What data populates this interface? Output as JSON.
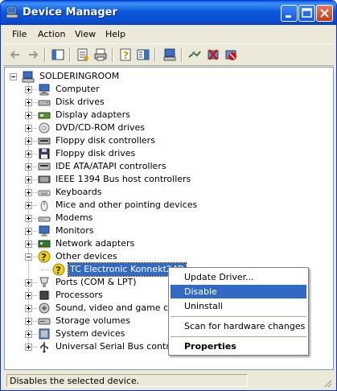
{
  "window": {
    "title": "Device Manager",
    "titlebar_color": "#0a54d8",
    "controls": [
      "minimize-icon",
      "maximize-icon",
      "close-icon"
    ]
  },
  "menubar": {
    "items": [
      "File",
      "Action",
      "View",
      "Help"
    ]
  },
  "toolbar": {
    "icons": [
      "back-arrow-icon",
      "forward-arrow-icon",
      "show-hide-console-tree-icon",
      "properties-icon",
      "print-icon",
      "help-icon",
      "view-icon",
      "computer-icon",
      "scan-hardware-icon",
      "update-driver-icon",
      "uninstall-icon",
      "disable-icon"
    ]
  },
  "tree": {
    "root": "SOLDERINGROOM",
    "categories": [
      {
        "label": "Computer",
        "icon": "computer-icon"
      },
      {
        "label": "Disk drives",
        "icon": "disk-drive-icon"
      },
      {
        "label": "Display adapters",
        "icon": "display-adapter-icon"
      },
      {
        "label": "DVD/CD-ROM drives",
        "icon": "cd-drive-icon"
      },
      {
        "label": "Floppy disk controllers",
        "icon": "floppy-controller-icon"
      },
      {
        "label": "Floppy disk drives",
        "icon": "floppy-drive-icon"
      },
      {
        "label": "IDE ATA/ATAPI controllers",
        "icon": "ide-controller-icon"
      },
      {
        "label": "IEEE 1394 Bus host controllers",
        "icon": "firewire-icon"
      },
      {
        "label": "Keyboards",
        "icon": "keyboard-icon"
      },
      {
        "label": "Mice and other pointing devices",
        "icon": "mouse-icon"
      },
      {
        "label": "Modems",
        "icon": "modem-icon"
      },
      {
        "label": "Monitors",
        "icon": "monitor-icon"
      },
      {
        "label": "Network adapters",
        "icon": "network-adapter-icon"
      },
      {
        "label": "Other devices",
        "icon": "unknown-device-icon",
        "expanded": true
      },
      {
        "label": "TC Electronic Konnekt24D",
        "icon": "unknown-device-icon",
        "child": true,
        "selected": true
      },
      {
        "label": "Ports (COM & LPT)",
        "icon": "port-icon"
      },
      {
        "label": "Processors",
        "icon": "processor-icon"
      },
      {
        "label": "Sound, video and game contro",
        "icon": "sound-icon"
      },
      {
        "label": "Storage volumes",
        "icon": "storage-volume-icon"
      },
      {
        "label": "System devices",
        "icon": "system-device-icon"
      },
      {
        "label": "Universal Serial Bus controllers",
        "icon": "usb-icon"
      }
    ]
  },
  "context_menu": {
    "items": [
      {
        "label": "Update Driver...",
        "highlighted": false
      },
      {
        "label": "Disable",
        "highlighted": true
      },
      {
        "label": "Uninstall",
        "highlighted": false
      },
      {
        "separator": true
      },
      {
        "label": "Scan for hardware changes",
        "highlighted": false
      },
      {
        "separator": true
      },
      {
        "label": "Properties",
        "bold": true,
        "highlighted": false
      }
    ],
    "highlight_color": "#316ac5"
  },
  "statusbar": {
    "text": "Disables the selected device."
  }
}
